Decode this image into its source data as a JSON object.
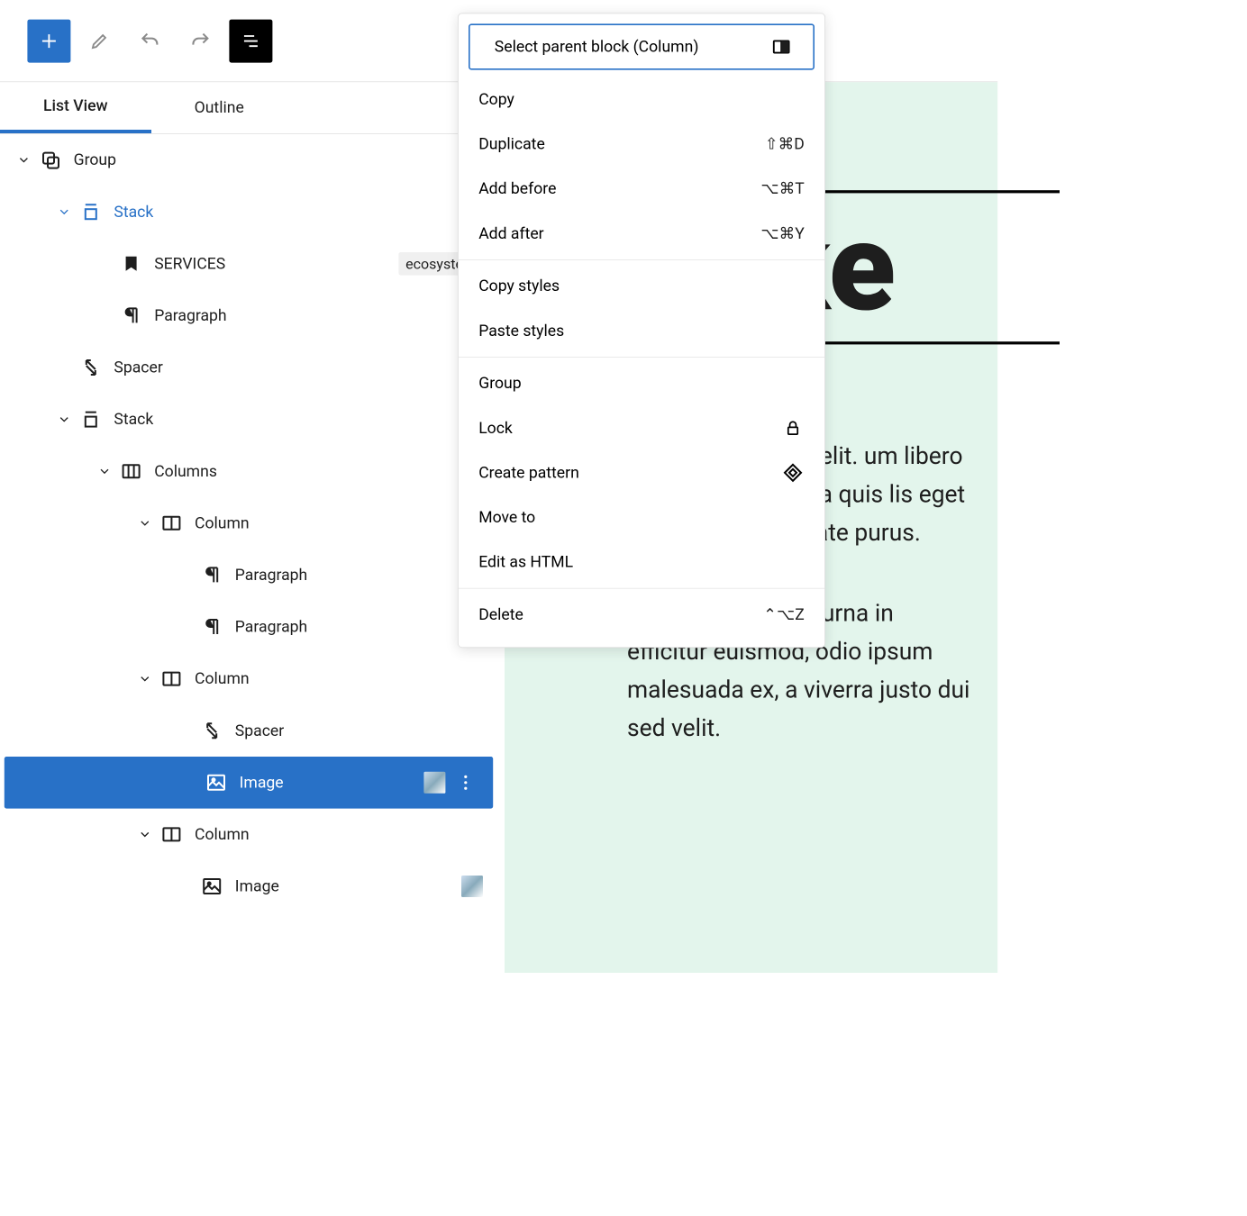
{
  "toolbar": {
    "add": "+",
    "edit": "edit",
    "undo": "undo",
    "redo": "redo",
    "listview": "listview"
  },
  "tabs": {
    "listview": "List View",
    "outline": "Outline"
  },
  "tree": [
    {
      "id": "group",
      "indent": 0,
      "chev": "down",
      "icon": "group",
      "label": "Group"
    },
    {
      "id": "stack1",
      "indent": 1,
      "chev": "down",
      "icon": "stack",
      "label": "Stack",
      "accent": true
    },
    {
      "id": "svc",
      "indent": 2,
      "chev": "",
      "icon": "bookmark",
      "label": "SERVICES",
      "tag": "ecosystem"
    },
    {
      "id": "para1",
      "indent": 2,
      "chev": "",
      "icon": "paragraph",
      "label": "Paragraph"
    },
    {
      "id": "spacer1",
      "indent": 1,
      "chev": "",
      "icon": "spacer",
      "label": "Spacer"
    },
    {
      "id": "stack2",
      "indent": 1,
      "chev": "down",
      "icon": "stack",
      "label": "Stack"
    },
    {
      "id": "columns",
      "indent": 2,
      "chev": "down",
      "icon": "columns",
      "label": "Columns"
    },
    {
      "id": "col1",
      "indent": 3,
      "chev": "down",
      "icon": "column",
      "label": "Column"
    },
    {
      "id": "para2",
      "indent": 4,
      "chev": "",
      "icon": "paragraph",
      "label": "Paragraph"
    },
    {
      "id": "para3",
      "indent": 4,
      "chev": "",
      "icon": "paragraph",
      "label": "Paragraph"
    },
    {
      "id": "col2",
      "indent": 3,
      "chev": "down",
      "icon": "column",
      "label": "Column"
    },
    {
      "id": "spacer2",
      "indent": 4,
      "chev": "",
      "icon": "spacer",
      "label": "Spacer"
    },
    {
      "id": "image1",
      "indent": 4,
      "chev": "",
      "icon": "image",
      "label": "Image",
      "selected": true,
      "thumb": true,
      "more": true
    },
    {
      "id": "col3",
      "indent": 3,
      "chev": "down",
      "icon": "column",
      "label": "Column"
    },
    {
      "id": "image2",
      "indent": 4,
      "chev": "",
      "icon": "image",
      "label": "Image",
      "thumb": true
    }
  ],
  "preview": {
    "title": "okke",
    "p1": "or sit amet, iscing elit. um libero at n faucibus. porta quis lis eget mi. varius, , vulputate purus.",
    "p2": "Fusce sollicitudin, urna in efficitur euismod, odio ipsum malesuada ex, a viverra justo dui sed velit."
  },
  "menu": {
    "parent": "Select parent block (Column)",
    "copy": "Copy",
    "duplicate": "Duplicate",
    "dup_key": "⇧⌘D",
    "add_before": "Add before",
    "add_before_key": "⌥⌘T",
    "add_after": "Add after",
    "add_after_key": "⌥⌘Y",
    "copy_styles": "Copy styles",
    "paste_styles": "Paste styles",
    "group": "Group",
    "lock": "Lock",
    "create_pattern": "Create pattern",
    "move_to": "Move to",
    "edit_html": "Edit as HTML",
    "delete": "Delete",
    "delete_key": "⌃⌥Z"
  }
}
